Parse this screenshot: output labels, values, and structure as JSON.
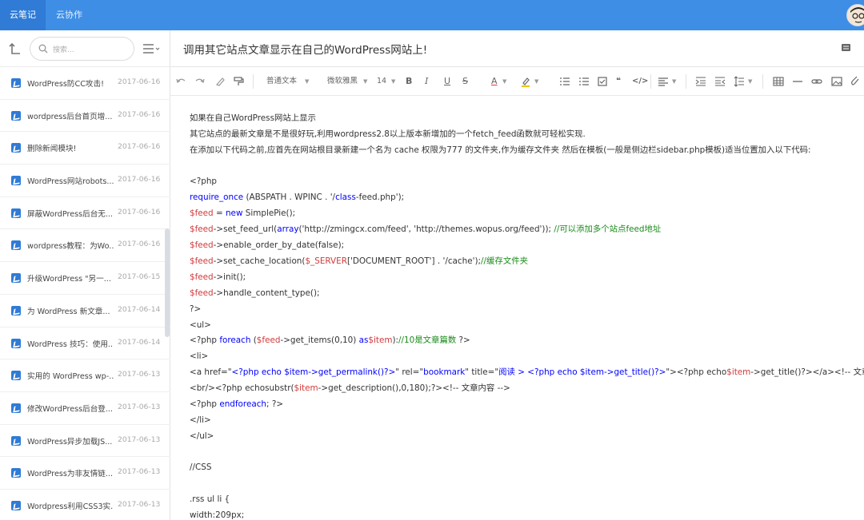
{
  "topbar": {
    "tabs": [
      "云笔记",
      "云协作"
    ]
  },
  "sidebar": {
    "search_placeholder": "搜索...",
    "notes": [
      {
        "title": "WordPress防CC攻击!",
        "date": "2017-06-16"
      },
      {
        "title": "wordpress后台首页增...",
        "date": "2017-06-16"
      },
      {
        "title": "删除新闻模块!",
        "date": "2017-06-16"
      },
      {
        "title": "WordPress网站robots....",
        "date": "2017-06-16"
      },
      {
        "title": "屏蔽WordPress后台无...",
        "date": "2017-06-16"
      },
      {
        "title": "wordpress教程：为Wo...",
        "date": "2017-06-16"
      },
      {
        "title": "升级WordPress \"另一...",
        "date": "2017-06-15"
      },
      {
        "title": "为 WordPress 新文章...",
        "date": "2017-06-14"
      },
      {
        "title": "WordPress 技巧：使用...",
        "date": "2017-06-14"
      },
      {
        "title": "实用的 WordPress wp-...",
        "date": "2017-06-13"
      },
      {
        "title": "修改WordPress后台登...",
        "date": "2017-06-13"
      },
      {
        "title": "WordPress异步加载JS...",
        "date": "2017-06-13"
      },
      {
        "title": "WordPress为非友情链...",
        "date": "2017-06-13"
      },
      {
        "title": "Wordpress利用CSS3实...",
        "date": "2017-06-13"
      }
    ]
  },
  "main": {
    "title": "调用其它站点文章显示在自己的WordPress网站上!",
    "toolbar": {
      "paragraph_style": "普通文本",
      "font_family": "微软雅黑",
      "font_size": "14"
    },
    "content": {
      "intro": [
        "如果在自己WordPress网站上显示",
        "其它站点的最新文章是不是很好玩,利用wordpress2.8以上版本新增加的一个fetch_feed函数就可轻松实现.",
        "在添加以下代码之前,应首先在网站根目录新建一个名为 cache  权限为777 的文件夹,作为缓存文件夹 然后在模板(一般是侧边栏sidebar.php模板)适当位置加入以下代码:"
      ],
      "code": {
        "l1": "<?php",
        "l2_kw": "require_once",
        "l2_rest": " (ABSPATH . WPINC . '/",
        "l2_kw2": "class",
        "l2_rest2": "-feed.php');",
        "l3_var": "$feed",
        "l3_mid": " = ",
        "l3_kw": "new",
        "l3_rest": " SimplePie();",
        "l4_var": "$feed",
        "l4_a": "->set_feed_url(",
        "l4_kw": "array",
        "l4_b": "('http://zmingcx.com/feed', 'http://themes.wopus.org/feed')); ",
        "l4_cm": "//可以添加多个站点feed地址",
        "l5_var": "$feed",
        "l5_rest": "->enable_order_by_date(false);",
        "l6_var": "$feed",
        "l6_a": "->set_cache_location(",
        "l6_var2": "$_SERVER",
        "l6_b": "['DOCUMENT_ROOT'] . '/cache');",
        "l6_cm": "//缓存文件夹",
        "l7_var": "$feed",
        "l7_rest": "->init();",
        "l8_var": "$feed",
        "l8_rest": "->handle_content_type();",
        "l9": "?>",
        "l10": "<ul>",
        "l11_a": "<?php ",
        "l11_kw": "foreach",
        "l11_b": " (",
        "l11_var": "$feed",
        "l11_c": "->get_items(0,10) ",
        "l11_kw2": "as",
        "l11_var2": "$item",
        "l11_d": "):",
        "l11_cm": "//10是文章篇数",
        "l11_e": " ?>",
        "l12": "<li>",
        "l13_a": "<a href=\"",
        "l13_b": "<?php echo $item->get_permalink()?>",
        "l13_c": "\" rel=\"",
        "l13_d": "bookmark",
        "l13_e": "\" title=\"",
        "l13_f": "阅读 > <?php echo $item->get_title()?>",
        "l13_g": "\"><?php echo",
        "l13_var": "$item",
        "l13_h": "->get_title()?></a><!-- 文章标题 -->",
        "l14_a": "<br/><?php echosubstr(",
        "l14_var": "$item",
        "l14_b": "->get_description(),0,180);?><!-- 文章内容 -->",
        "l15_a": "<?php ",
        "l15_kw": "endforeach",
        "l15_b": "; ?>",
        "l16": "</li>",
        "l17": "</ul>",
        "l18": "//CSS",
        "l19": ".rss ul li {",
        "l20": "width:209px;"
      }
    }
  }
}
